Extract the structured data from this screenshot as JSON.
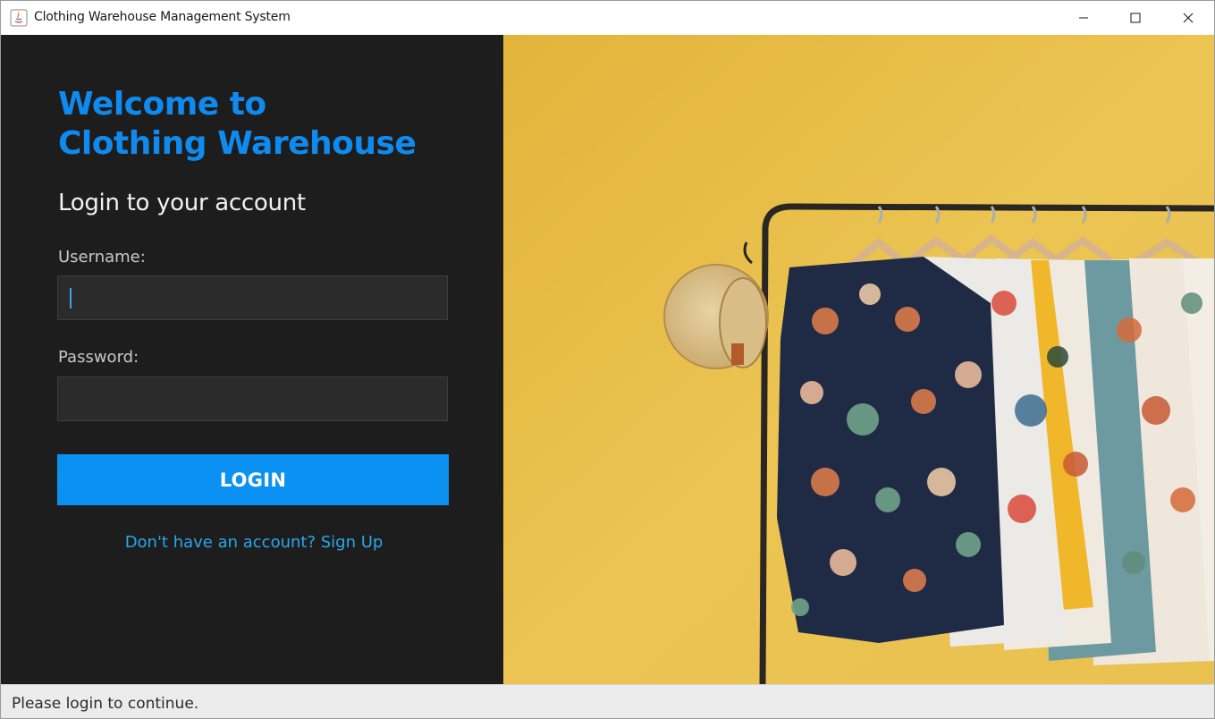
{
  "window": {
    "title": "Clothing Warehouse Management System",
    "icon": "java-app-icon"
  },
  "login": {
    "welcome_line1": "Welcome to",
    "welcome_line2": "Clothing Warehouse",
    "subtitle": "Login to your account",
    "username_label": "Username:",
    "username_value": "",
    "password_label": "Password:",
    "password_value": "",
    "login_button": "LOGIN",
    "signup_link": "Don't have an account? Sign Up"
  },
  "status": {
    "text": "Please login to continue."
  },
  "colors": {
    "panel_bg": "#1d1d1e",
    "accent_blue": "#0f8bef",
    "button_blue": "#0a91f2",
    "link_blue": "#28a8e8",
    "photo_bg": "#e4b93d"
  }
}
